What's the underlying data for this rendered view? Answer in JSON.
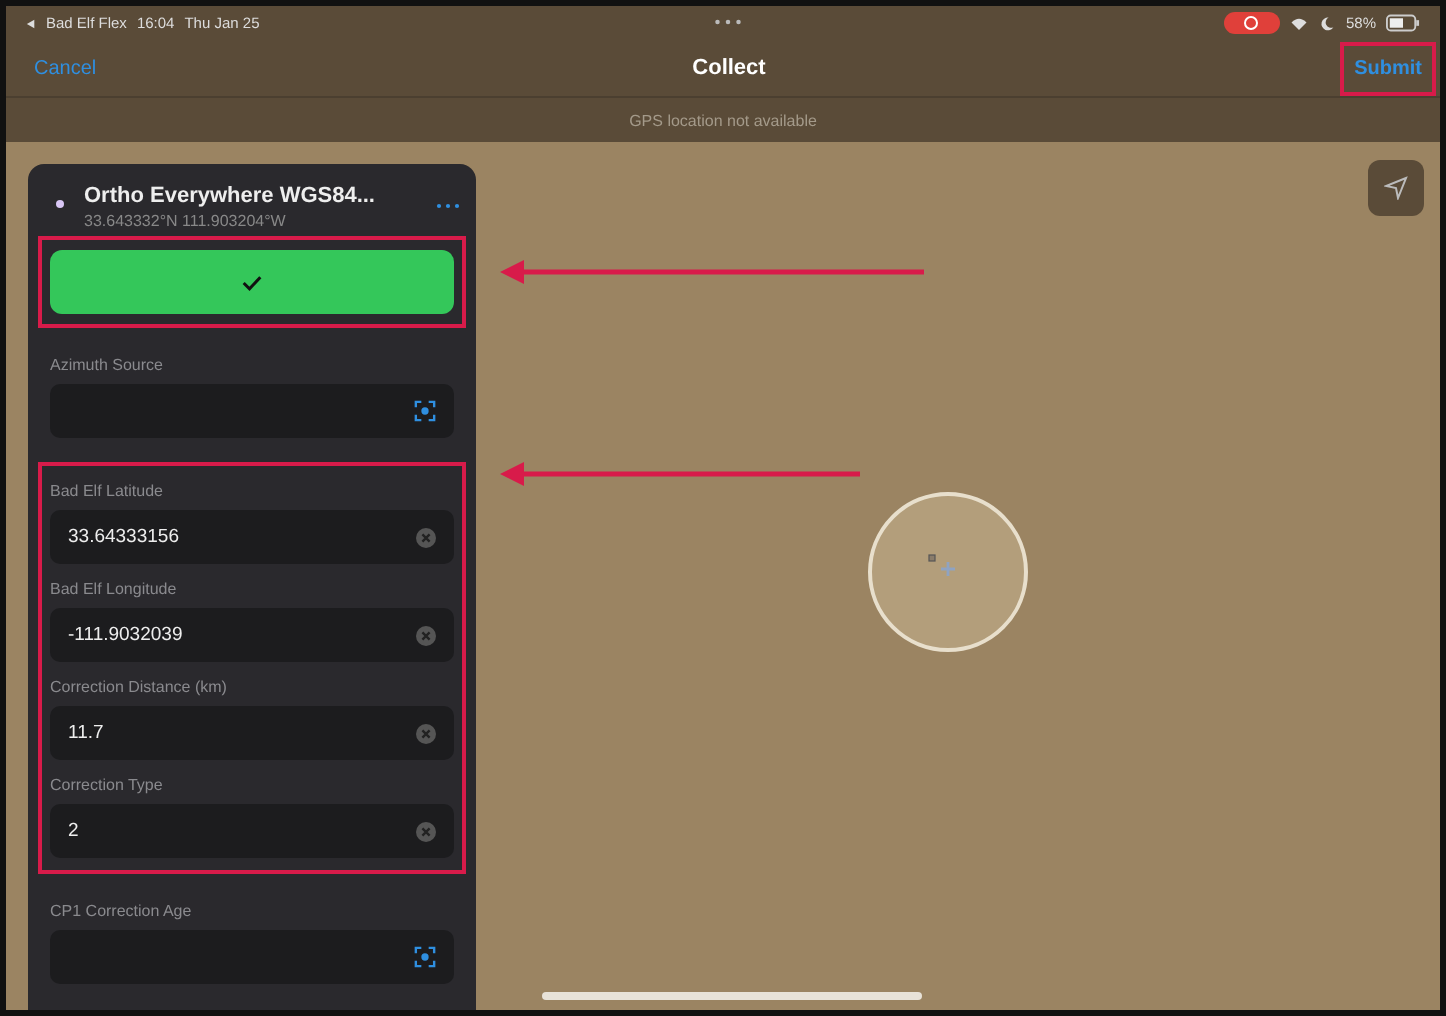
{
  "status_bar": {
    "back_app": "Bad Elf Flex",
    "time": "16:04",
    "date": "Thu Jan 25",
    "battery": "58%",
    "recording": true
  },
  "nav": {
    "cancel": "Cancel",
    "title": "Collect",
    "submit": {
      "label": "Submit",
      "highlighted": true
    }
  },
  "banner": "GPS location not available",
  "panel": {
    "title": "Ortho Everywhere WGS84...",
    "coordinates": "33.643332°N  111.903204°W",
    "confirm_button": {
      "highlighted": true
    },
    "groups": [
      {
        "highlighted": false,
        "fields": [
          {
            "label": "Azimuth Source",
            "kind": "scan"
          }
        ]
      },
      {
        "highlighted": true,
        "fields": [
          {
            "label": "Bad Elf Latitude",
            "value": "33.64333156",
            "kind": "clear"
          },
          {
            "label": "Bad Elf Longitude",
            "value": "-111.9032039",
            "kind": "clear"
          },
          {
            "label": "Correction Distance (km)",
            "value": "11.7",
            "kind": "clear"
          },
          {
            "label": "Correction Type",
            "value": "2",
            "kind": "clear"
          }
        ]
      },
      {
        "highlighted": false,
        "fields": [
          {
            "label": "CP1 Correction Age",
            "kind": "scan"
          }
        ]
      }
    ]
  }
}
